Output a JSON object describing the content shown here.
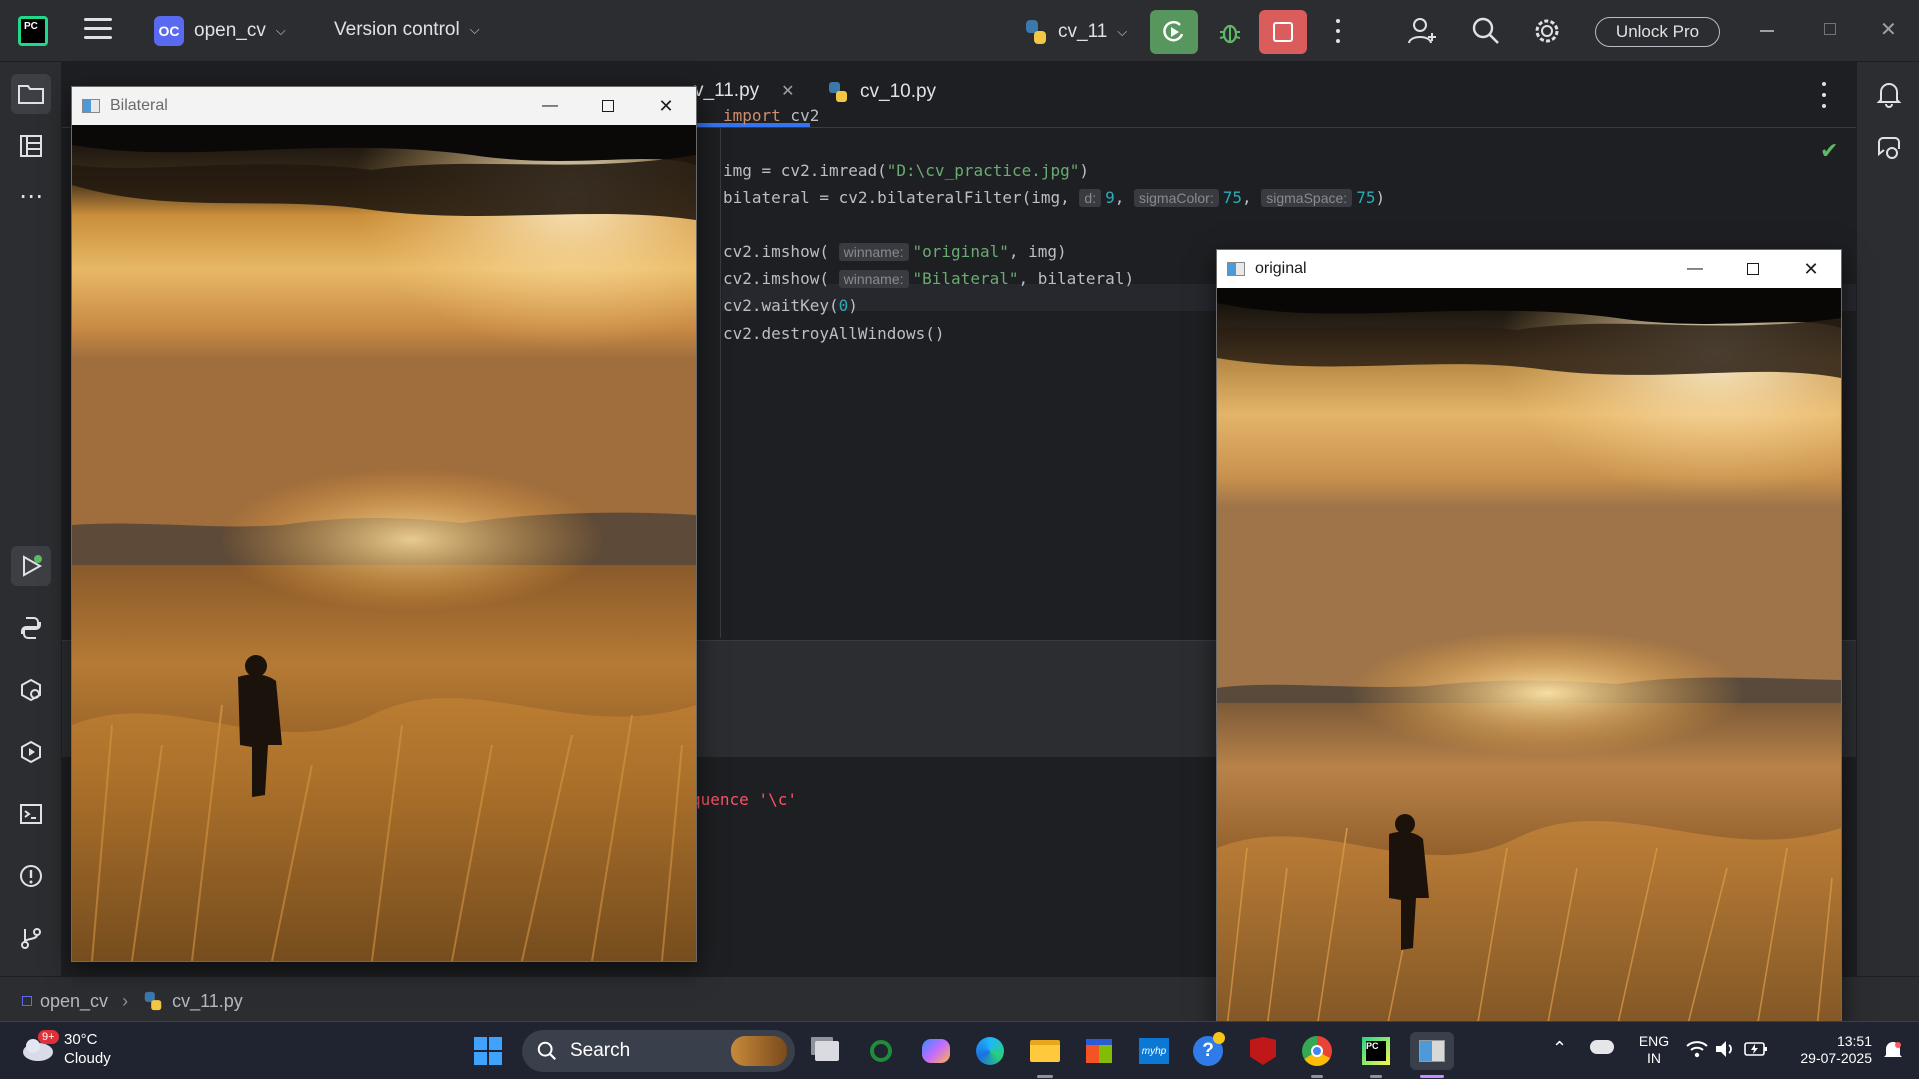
{
  "ide": {
    "project_badge": "OC",
    "project_name": "open_cv",
    "version_control": "Version control",
    "run_config": "cv_11",
    "unlock_pro": "Unlock Pro"
  },
  "tabs": [
    {
      "label": "cv_11.py",
      "visible_label": "v_11.py",
      "active": true
    },
    {
      "label": "cv_10.py",
      "active": false
    }
  ],
  "code_lines": [
    "import cv2",
    "",
    "img = cv2.imread(\"D:\\cv_practice.jpg\")",
    "bilateral = cv2.bilateralFilter(img, d: 9, sigmaColor: 75, sigmaSpace: 75)",
    "",
    "cv2.imshow( winname: \"original\", img)",
    "cv2.imshow( winname: \"Bilateral\", bilateral)",
    "cv2.waitKey(0)",
    "cv2.destroyAllWindows()"
  ],
  "code": {
    "l1_kw": "import",
    "l1_rest": " cv2",
    "l3_a": "img = cv2.imread(",
    "l3_str": "\"D:\\cv_practice.jpg\"",
    "l3_b": ")",
    "l4_a": "bilateral = cv2.bilateralFilter(img, ",
    "l4_hint_d": "d:",
    "l4_d": "9",
    "l4_sep1": ", ",
    "l4_hint_sc": "sigmaColor:",
    "l4_sc": "75",
    "l4_sep2": ", ",
    "l4_hint_ss": "sigmaSpace:",
    "l4_ss": "75",
    "l4_end": ")",
    "l6_a": "cv2.imshow( ",
    "l6_hint": "winname:",
    "l6_str": "\"original\"",
    "l6_b": ", img)",
    "l7_a": "cv2.imshow( ",
    "l7_hint": "winname:",
    "l7_str": "\"Bilateral\"",
    "l7_b": ", bilateral)",
    "l8_a": "cv2.waitKey(",
    "l8_num": "0",
    "l8_b": ")",
    "l9": "cv2.destroyAllWindows()"
  },
  "console": {
    "warning_fragment": "quence '\\c'"
  },
  "windows": {
    "bilateral_title": "Bilateral",
    "original_title": "original"
  },
  "breadcrumb": {
    "project": "open_cv",
    "file": "cv_11.py"
  },
  "taskbar": {
    "weather_badge": "9+",
    "temperature": "30°C",
    "condition": "Cloudy",
    "search_label": "Search",
    "lang_top": "ENG",
    "lang_bottom": "IN",
    "time": "13:51",
    "date": "29-07-2025"
  },
  "colors": {
    "run_green": "#57965c",
    "stop_red": "#db5c5c",
    "accent_blue": "#5a6af0"
  }
}
